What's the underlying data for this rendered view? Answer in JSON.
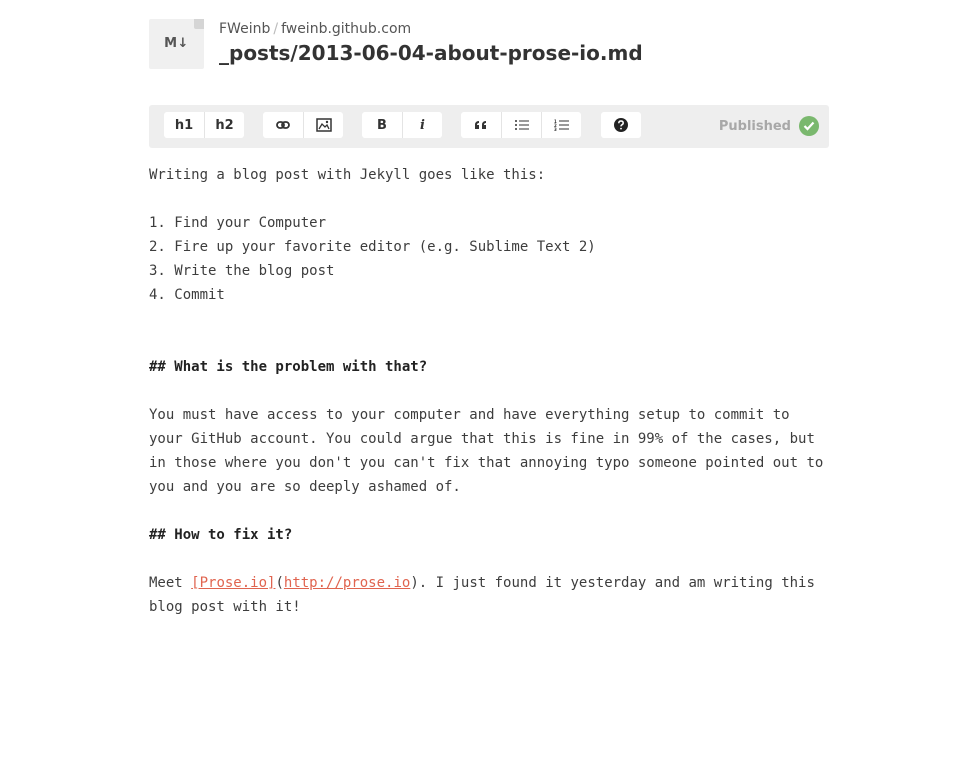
{
  "header": {
    "file_badge": "M↓",
    "owner": "FWeinb",
    "separator": "/",
    "repo": "fweinb.github.com",
    "file_path": "_posts/2013-06-04-about-prose-io.md"
  },
  "toolbar": {
    "h1_label": "h1",
    "h2_label": "h2",
    "bold_label": "B",
    "italic_label": "i",
    "status_label": "Published",
    "icons": [
      "link-icon",
      "image-icon",
      "quote-icon",
      "bullet-list-icon",
      "numbered-list-icon",
      "help-icon",
      "check-icon"
    ],
    "colors": {
      "toolbar_bg": "#eeeeee",
      "status_ok": "#7ab86e",
      "link": "#e0644f"
    }
  },
  "editor": {
    "intro": "Writing a blog post with Jekyll goes like this:",
    "list": [
      "1. Find your Computer",
      "2. Fire up your favorite editor (e.g. Sublime Text 2)",
      "3. Write the blog post",
      "4. Commit"
    ],
    "heading1": "## What is the problem with that?",
    "paragraph1": "You must have access to your computer and have everything setup to commit to your GitHub account. You could argue that this is fine in 99% of the cases, but in those where you don't you can't fix that annoying typo someone pointed out to you and you are so deeply ashamed of.",
    "heading2": "## How to fix it?",
    "meet_prefix": "Meet ",
    "link_text": "[Prose.io]",
    "link_open": "(",
    "link_url": "http://prose.io",
    "link_close": ")",
    "meet_suffix": ". I just found it yesterday and am writing this blog post with it!"
  }
}
